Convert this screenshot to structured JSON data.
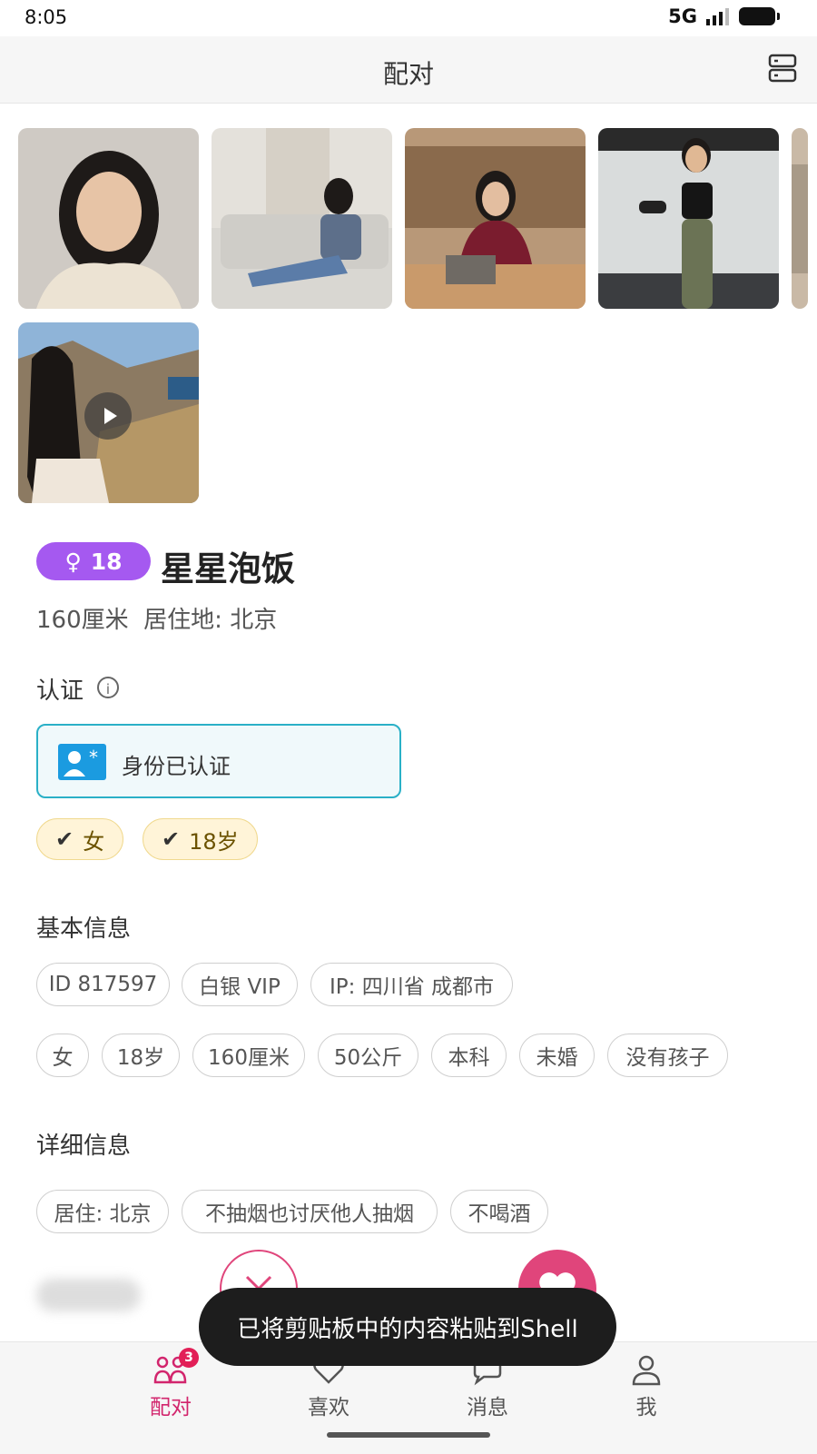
{
  "status_bar": {
    "time": "8:05",
    "network": "5G"
  },
  "header": {
    "title": "配对"
  },
  "profile": {
    "gender_symbol": "♀",
    "age": "18",
    "nickname": "星星泡饭",
    "height": "160厘米",
    "residence": "居住地: 北京",
    "photos": [
      {
        "desc": "portrait-photo"
      },
      {
        "desc": "reading-photo"
      },
      {
        "desc": "library-photo"
      },
      {
        "desc": "gym-photo"
      },
      {
        "desc": "mountain-video"
      }
    ]
  },
  "verification": {
    "title": "认证",
    "card_label": "身份已认证",
    "chips": [
      "女",
      "18岁"
    ]
  },
  "basic_info": {
    "title": "基本信息",
    "row1": [
      "ID 817597",
      "白银 VIP",
      "IP: 四川省 成都市"
    ],
    "row2": [
      "女",
      "18岁",
      "160厘米",
      "50公斤",
      "本科",
      "未婚",
      "没有孩子"
    ]
  },
  "details": {
    "title": "详细信息",
    "chips": [
      "居住: 北京",
      "不抽烟也讨厌他人抽烟",
      "不喝酒"
    ]
  },
  "toast": {
    "text": "已将剪贴板中的内容粘贴到Shell"
  },
  "bottom_nav": {
    "items": [
      {
        "label": "配对",
        "badge": "3"
      },
      {
        "label": "喜欢"
      },
      {
        "label": "消息"
      },
      {
        "label": "我"
      }
    ]
  },
  "colors": {
    "accent": "#d2256d",
    "gender_badge": "#a559f0",
    "verify_border": "#2ab0c7"
  }
}
